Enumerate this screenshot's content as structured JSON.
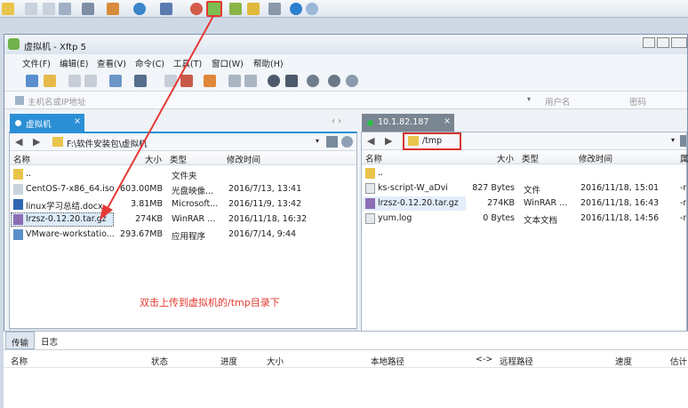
{
  "window": {
    "title": "虚拟机 - Xftp 5"
  },
  "menu": [
    "文件(F)",
    "编辑(E)",
    "查看(V)",
    "命令(C)",
    "工具(T)",
    "窗口(W)",
    "帮助(H)"
  ],
  "address": {
    "host_placeholder": "主机名或IP地址",
    "user_placeholder": "用户名",
    "password_placeholder": "密码"
  },
  "tabs": {
    "left": "虚拟机",
    "left_close": "×",
    "right": "10.1.82.187",
    "right_close": "×"
  },
  "left_pane": {
    "path": "F:\\软件安装包\\虚拟机",
    "columns": [
      "名称",
      "大小",
      "类型",
      "修改时间"
    ],
    "rows": [
      {
        "name": "..",
        "size": "",
        "type": "文件夹",
        "modified": ""
      },
      {
        "name": "CentOS-7-x86_64.iso",
        "size": "603.00MB",
        "type": "光盘映像...",
        "modified": "2016/7/13, 13:41"
      },
      {
        "name": "linux学习总结.docx",
        "size": "3.81MB",
        "type": "Microsoft...",
        "modified": "2016/11/9, 13:42"
      },
      {
        "name": "lrzsz-0.12.20.tar.gz",
        "size": "274KB",
        "type": "WinRAR ...",
        "modified": "2016/11/18, 16:32"
      },
      {
        "name": "VMware-workstatio...",
        "size": "293.67MB",
        "type": "应用程序",
        "modified": "2016/7/14, 9:44"
      }
    ]
  },
  "right_pane": {
    "path": "/tmp",
    "columns": [
      "名称",
      "大小",
      "类型",
      "修改时间",
      "属"
    ],
    "rows": [
      {
        "name": "..",
        "size": "",
        "type": "",
        "modified": "",
        "attr": ""
      },
      {
        "name": "ks-script-W_aDvi",
        "size": "827 Bytes",
        "type": "文件",
        "modified": "2016/11/18, 15:01",
        "attr": "-r"
      },
      {
        "name": "lrzsz-0.12.20.tar.gz",
        "size": "274KB",
        "type": "WinRAR ...",
        "modified": "2016/11/18, 16:43",
        "attr": "-r"
      },
      {
        "name": "yum.log",
        "size": "0 Bytes",
        "type": "文本文档",
        "modified": "2016/11/18, 14:56",
        "attr": "-r"
      }
    ]
  },
  "annotation": "双击上传到虚拟机的/tmp目录下",
  "transfer": {
    "tabs": [
      "传输",
      "日志"
    ],
    "columns": [
      "名称",
      "状态",
      "进度",
      "大小",
      "本地路径",
      "<->",
      "远程路径",
      "速度",
      "估计"
    ]
  },
  "colors": {
    "accent": "#2b8fd6",
    "annotation": "#e03a2f",
    "highlight_box": "#d9332a"
  }
}
